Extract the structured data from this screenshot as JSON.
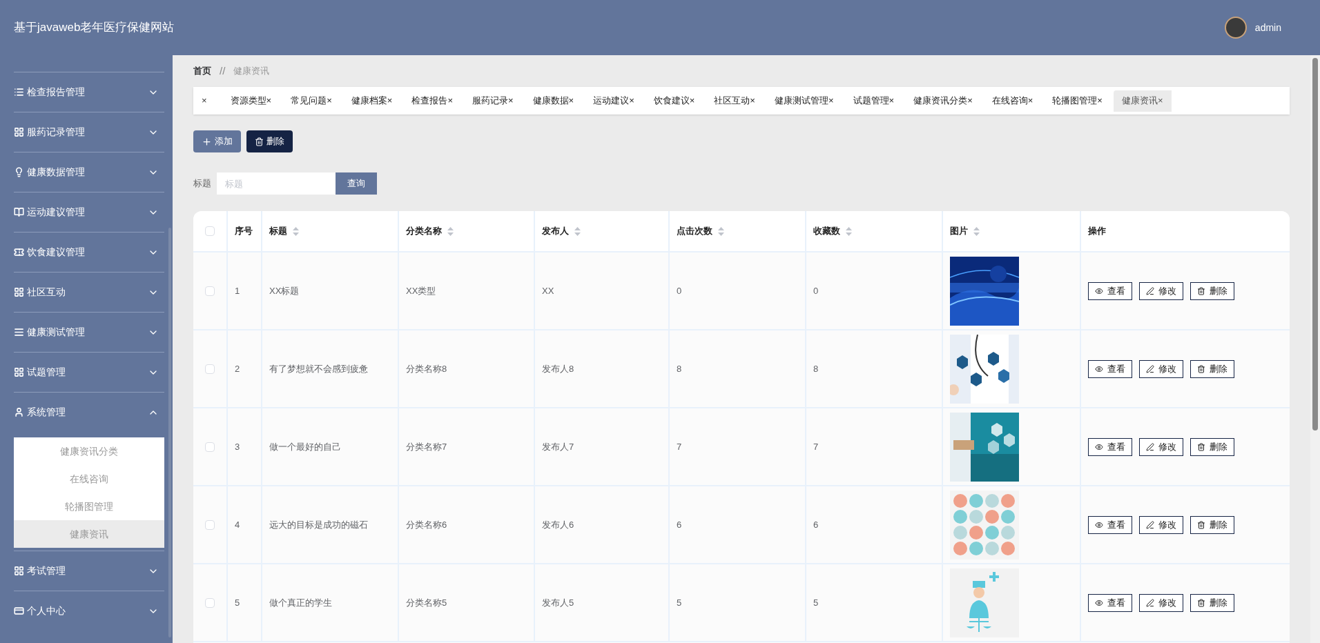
{
  "header": {
    "title": "基于javaweb老年医疗保健网站",
    "user": "admin"
  },
  "sidebar": {
    "items": [
      {
        "label": "检查报告管理",
        "expanded": false
      },
      {
        "label": "服药记录管理",
        "expanded": false
      },
      {
        "label": "健康数据管理",
        "expanded": false
      },
      {
        "label": "运动建议管理",
        "expanded": false
      },
      {
        "label": "饮食建议管理",
        "expanded": false
      },
      {
        "label": "社区互动",
        "expanded": false
      },
      {
        "label": "健康测试管理",
        "expanded": false
      },
      {
        "label": "试题管理",
        "expanded": false
      },
      {
        "label": "系统管理",
        "expanded": true,
        "children": [
          {
            "label": "健康资讯分类",
            "selected": false
          },
          {
            "label": "在线咨询",
            "selected": false
          },
          {
            "label": "轮播图管理",
            "selected": false
          },
          {
            "label": "健康资讯",
            "selected": true
          }
        ]
      },
      {
        "label": "考试管理",
        "expanded": false
      },
      {
        "label": "个人中心",
        "expanded": false
      }
    ]
  },
  "breadcrumb": [
    "首页",
    "健康资讯"
  ],
  "breadcrumb_separator": "//",
  "close_all": "×",
  "tabs": [
    {
      "label": "资源类型",
      "selected": false
    },
    {
      "label": "常见问题",
      "selected": false
    },
    {
      "label": "健康档案",
      "selected": false
    },
    {
      "label": "检查报告",
      "selected": false
    },
    {
      "label": "服药记录",
      "selected": false
    },
    {
      "label": "健康数据",
      "selected": false
    },
    {
      "label": "运动建议",
      "selected": false
    },
    {
      "label": "饮食建议",
      "selected": false
    },
    {
      "label": "社区互动",
      "selected": false
    },
    {
      "label": "健康测试管理",
      "selected": false
    },
    {
      "label": "试题管理",
      "selected": false
    },
    {
      "label": "健康资讯分类",
      "selected": false
    },
    {
      "label": "在线咨询",
      "selected": false
    },
    {
      "label": "轮播图管理",
      "selected": false
    },
    {
      "label": "健康资讯",
      "selected": true
    }
  ],
  "tab_close": "×",
  "actions": {
    "add": "添加",
    "delete": "删除"
  },
  "search": {
    "label": "标题",
    "placeholder": "标题",
    "button": "查询"
  },
  "table": {
    "columns": [
      {
        "label": "序号",
        "sortable": false
      },
      {
        "label": "标题",
        "sortable": true
      },
      {
        "label": "分类名称",
        "sortable": true
      },
      {
        "label": "发布人",
        "sortable": true
      },
      {
        "label": "点击次数",
        "sortable": true
      },
      {
        "label": "收藏数",
        "sortable": true
      },
      {
        "label": "图片",
        "sortable": true
      },
      {
        "label": "操作",
        "sortable": false
      }
    ],
    "rows": [
      {
        "checked": false,
        "cells": [
          "1",
          "XX标题",
          "XX类型",
          "XX",
          "0",
          "0"
        ],
        "actions": {
          "view": "查看",
          "edit": "修改",
          "delete": "删除"
        }
      },
      {
        "checked": false,
        "cells": [
          "2",
          "有了梦想就不会感到疲惫",
          "分类名称8",
          "发布人8",
          "8",
          "8"
        ],
        "actions": {
          "view": "查看",
          "edit": "修改",
          "delete": "删除"
        }
      },
      {
        "checked": false,
        "cells": [
          "3",
          "做一个最好的自己",
          "分类名称7",
          "发布人7",
          "7",
          "7"
        ],
        "actions": {
          "view": "查看",
          "edit": "修改",
          "delete": "删除"
        }
      },
      {
        "checked": false,
        "cells": [
          "4",
          "远大的目标是成功的磁石",
          "分类名称6",
          "发布人6",
          "6",
          "6"
        ],
        "actions": {
          "view": "查看",
          "edit": "修改",
          "delete": "删除"
        }
      },
      {
        "checked": false,
        "cells": [
          "5",
          "做个真正的学生",
          "分类名称5",
          "发布人5",
          "5",
          "5"
        ],
        "actions": {
          "view": "查看",
          "edit": "修改",
          "delete": "删除"
        }
      }
    ],
    "all_checked": false
  }
}
